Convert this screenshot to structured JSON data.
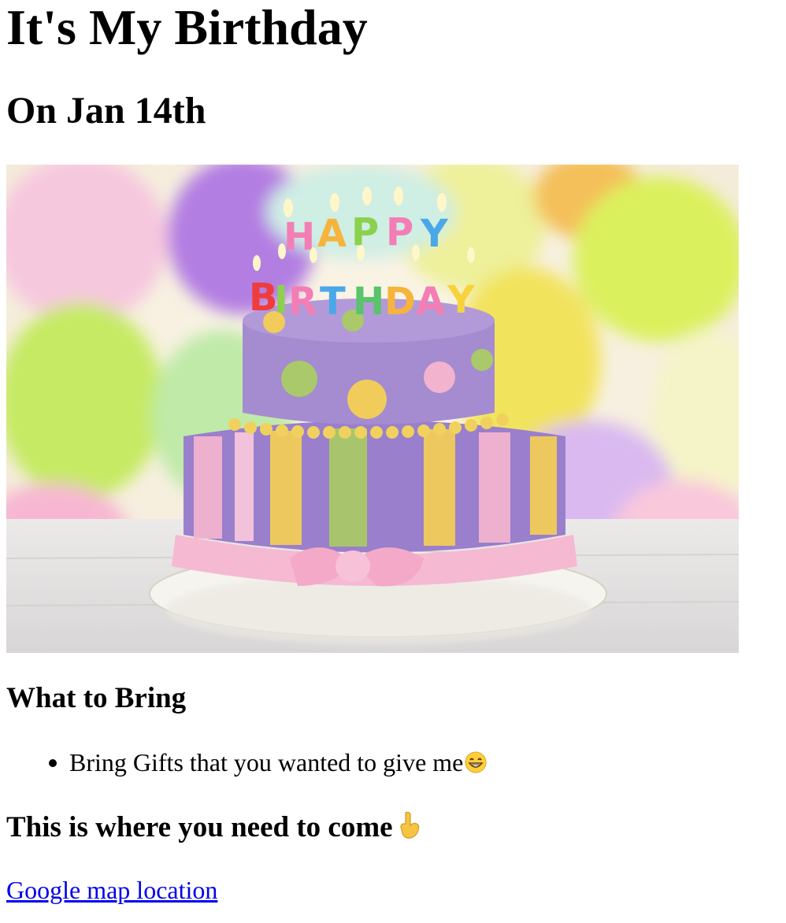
{
  "page": {
    "title": "It's My Birthday",
    "subtitle": "On Jan 14th"
  },
  "hero_image": {
    "alt": "Birthday cake",
    "caption_candles_top": "HAPPY",
    "caption_candles_bottom": "BIRTHDAY",
    "colors": {
      "cake_top": "#a58bd0",
      "cake_bottom": "#9a7fcc",
      "pink": "#f2b3cf",
      "yellow": "#f1cc5a",
      "green": "#a9c96a"
    }
  },
  "what_to_bring": {
    "heading": "What to Bring",
    "items": [
      {
        "text": "Bring Gifts that you wanted to give me",
        "emoji": "grinning-face-icon"
      }
    ]
  },
  "location": {
    "heading": "This is where you need to come",
    "emoji": "pointing-down-icon",
    "link_text": "Google map location",
    "link_color": "#0000ee"
  }
}
